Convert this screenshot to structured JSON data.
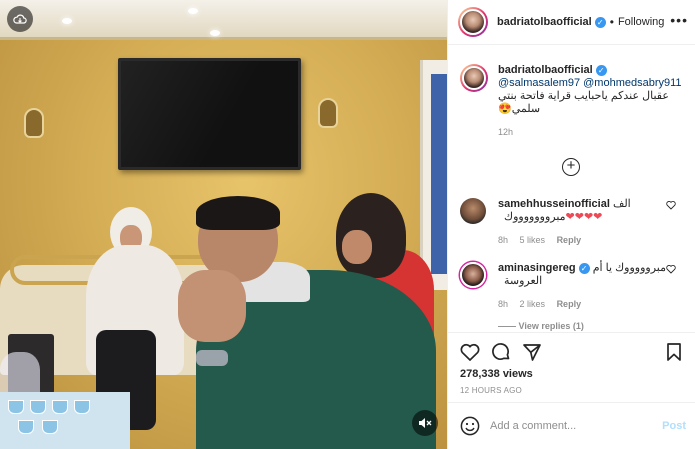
{
  "post": {
    "author": "badriatolbaofficial",
    "follow_status": "Following",
    "more_label": "•••",
    "dot": "•",
    "verified_mark": "✓"
  },
  "caption": {
    "author": "badriatolbaofficial",
    "mentions": "@salmasalem97 @mohmedsabry911",
    "text": "عقبال عندكم ياحبايب قراية فاتحة بنتي سلمي😍",
    "time": "12h"
  },
  "load_more": {
    "label": "+"
  },
  "comments": [
    {
      "author": "samehhusseinofficial",
      "text": "الف مبروووووووك",
      "hearts": "❤❤❤❤",
      "time": "8h",
      "likes": "5 likes",
      "reply": "Reply",
      "verified": false
    },
    {
      "author": "aminasingereg",
      "text": "مبروووووك يا أم العروسة",
      "time": "8h",
      "likes": "2 likes",
      "reply": "Reply",
      "verified": true
    }
  ],
  "view_replies": "—— View replies (1)",
  "actions": {
    "views": "278,338 views",
    "post_time": "12 HOURS AGO"
  },
  "composer": {
    "placeholder": "Add a comment...",
    "post_label": "Post"
  },
  "icons": {
    "cloud": "cloud-download-icon",
    "mute": "mute-icon",
    "like": "heart-icon",
    "comment": "comment-icon",
    "share": "share-icon",
    "save": "bookmark-icon",
    "emoji": "emoji-icon"
  },
  "colors": {
    "link": "#00376b",
    "verified": "#3897f0",
    "muted": "#8e8e8e",
    "heart": "#ed4956",
    "post_button": "#b2dffc"
  }
}
